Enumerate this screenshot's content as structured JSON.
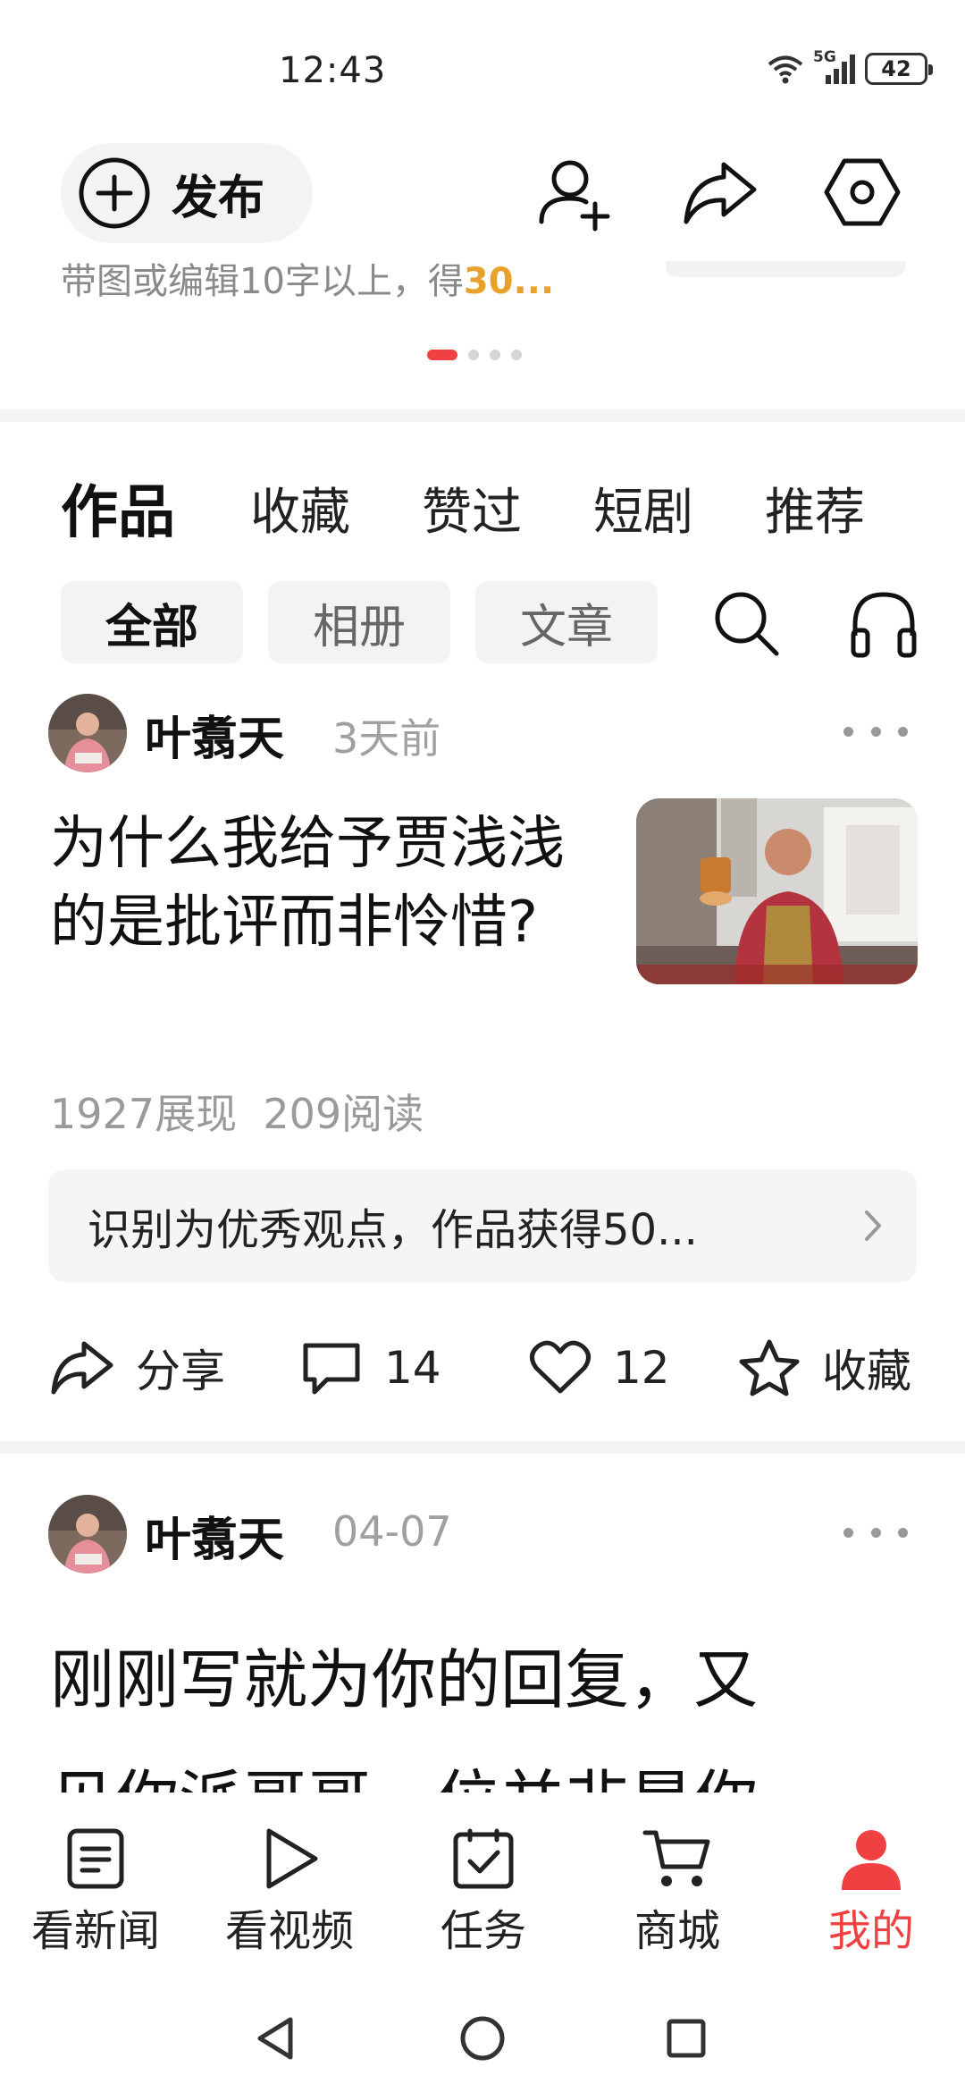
{
  "status_bar": {
    "time": "12:43",
    "network": "5G",
    "battery": "42"
  },
  "header": {
    "publish_label": "发布",
    "reward_text": "带图或编辑10字以上，得",
    "reward_highlight": "30..."
  },
  "colors": {
    "accent": "#f04142",
    "highlight": "#e8a12a",
    "muted": "#9a9a9a"
  },
  "tabs": [
    {
      "label": "作品",
      "active": true
    },
    {
      "label": "收藏"
    },
    {
      "label": "赞过"
    },
    {
      "label": "短剧"
    },
    {
      "label": "推荐"
    }
  ],
  "filters": [
    {
      "label": "全部",
      "active": true
    },
    {
      "label": "相册"
    },
    {
      "label": "文章"
    }
  ],
  "post1": {
    "author": "叶翥天",
    "time": "3天前",
    "title": "为什么我给予贾浅浅的是批评而非怜惜?",
    "views": "1927展现",
    "reads": "209阅读",
    "notice": "识别为优秀观点，作品获得50...",
    "share_label": "分享",
    "comments": "14",
    "likes": "12",
    "favorite_label": "收藏"
  },
  "post2": {
    "author": "叶翥天",
    "time": "04-07",
    "title": "刚刚写就为你的回复，又",
    "line2": "见你派哥哥一位并非是你"
  },
  "bottom_nav": [
    {
      "label": "看新闻",
      "icon": "news-icon"
    },
    {
      "label": "看视频",
      "icon": "video-play-icon"
    },
    {
      "label": "任务",
      "icon": "task-check-icon"
    },
    {
      "label": "商城",
      "icon": "cart-icon"
    },
    {
      "label": "我的",
      "icon": "person-icon",
      "active": true
    }
  ]
}
